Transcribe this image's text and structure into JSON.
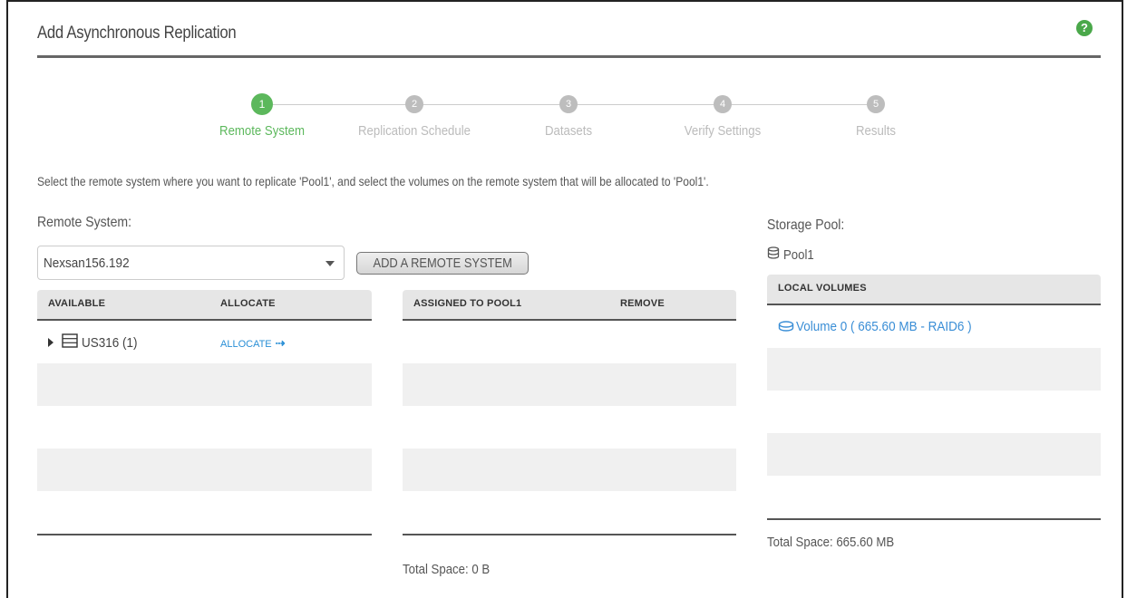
{
  "dialog": {
    "title": "Add Asynchronous Replication",
    "help_icon": "question-circle-icon",
    "help_symbol": "?"
  },
  "wizard": {
    "steps": [
      {
        "number": "1",
        "label": "Remote System",
        "active": true
      },
      {
        "number": "2",
        "label": "Replication Schedule",
        "active": false
      },
      {
        "number": "3",
        "label": "Datasets",
        "active": false
      },
      {
        "number": "4",
        "label": "Verify Settings",
        "active": false
      },
      {
        "number": "5",
        "label": "Results",
        "active": false
      }
    ]
  },
  "instructions": "Select the remote system where you want to replicate 'Pool1', and select the volumes on the remote system that will be allocated to 'Pool1'.",
  "remote_system": {
    "label": "Remote System:",
    "selected": "Nexsan156.192",
    "add_button": "ADD A REMOTE SYSTEM"
  },
  "available_table": {
    "headers": [
      "AVAILABLE",
      "ALLOCATE"
    ],
    "rows": [
      {
        "name": "US316 (1)",
        "action": "ALLOCATE",
        "action_icon": "double-arrow-right-icon"
      }
    ]
  },
  "assigned_table": {
    "headers": [
      "ASSIGNED TO POOL1",
      "REMOVE"
    ],
    "total": "Total Space: 0 B"
  },
  "storage_pool": {
    "label": "Storage Pool:",
    "pool_name": "Pool1",
    "pool_icon": "database-icon"
  },
  "local_volumes": {
    "header": "LOCAL VOLUMES",
    "rows": [
      {
        "text": "Volume 0 ( 665.60 MB - RAID6 )",
        "icon": "disk-icon"
      }
    ],
    "total": "Total Space: 665.60 MB"
  },
  "colors": {
    "active_step": "#5cb85c",
    "inactive_step": "#bdbdbd",
    "link": "#2a8fd6",
    "help": "#4aa84a"
  }
}
